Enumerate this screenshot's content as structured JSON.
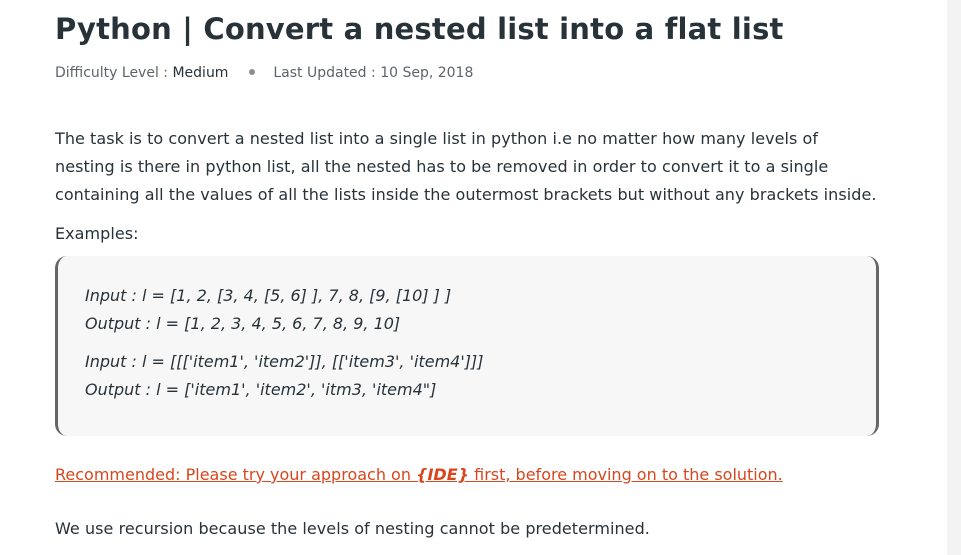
{
  "article": {
    "title": "Python | Convert a nested list into a flat list",
    "meta": {
      "difficulty_label": "Difficulty Level : ",
      "difficulty_value": "Medium",
      "updated_label": "Last Updated : ",
      "updated_value": "10 Sep, 2018"
    },
    "intro": "The task is to convert a nested list into a single list in python i.e no matter how many levels of nesting is there in python list, all the nested has to be removed in order to convert it to a single containing all the values of all the lists inside the outermost brackets but without any brackets inside.",
    "examples_label": "Examples:",
    "examples": [
      {
        "input": "Input : l = [1, 2, [3, 4, [5, 6] ], 7, 8, [9, [10] ] ]",
        "output": "Output : l = [1, 2, 3, 4, 5, 6, 7, 8, 9, 10]"
      },
      {
        "input": "Input : l = [[['item1', 'item2']], [['item3', 'item4']]]",
        "output": "Output : l = ['item1', 'item2', 'itm3, 'item4\"]"
      }
    ],
    "recommended": {
      "prefix": "Recommended: Please try your approach on ",
      "ide_link": "{IDE}",
      "suffix": " first, before moving on to the solution."
    },
    "recursion_note": "We use recursion because the levels of nesting cannot be predetermined."
  },
  "colors": {
    "text": "#273239",
    "meta_text": "#5e6468",
    "link": "#d6471f",
    "example_bg": "#f7f7f7",
    "example_border": "#666666"
  }
}
